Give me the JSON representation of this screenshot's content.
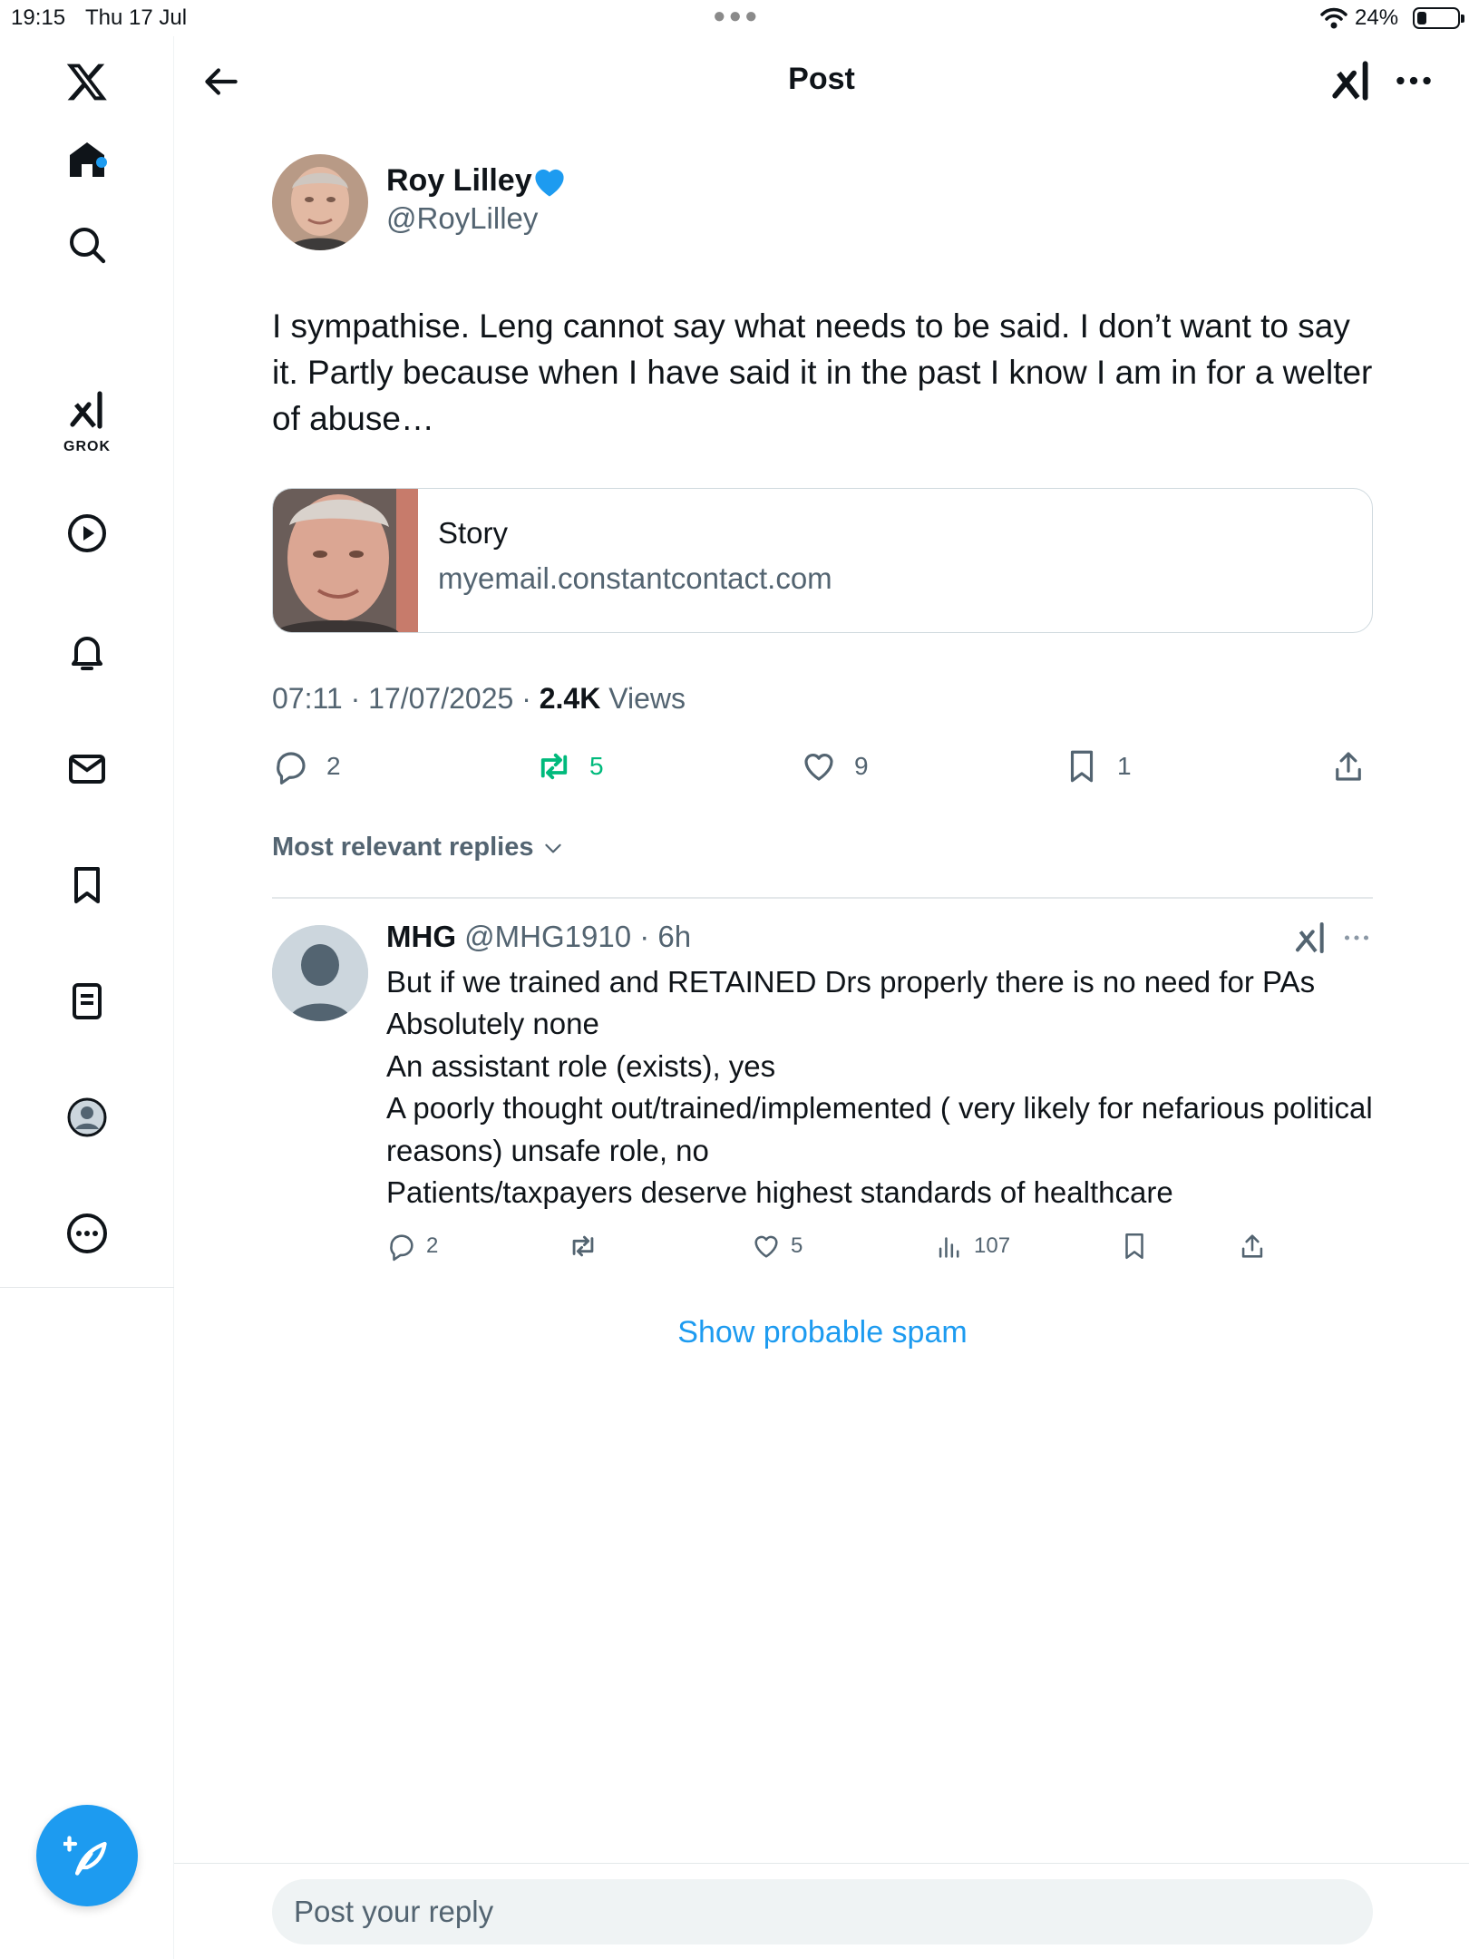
{
  "status_bar": {
    "time": "19:15",
    "date": "Thu 17 Jul",
    "battery": "24%"
  },
  "header": {
    "title": "Post"
  },
  "sidebar": {
    "grok_label": "GROK",
    "accent": "#1d9bf0"
  },
  "post": {
    "author_name": "Roy Lilley",
    "author_handle": "@RoyLilley",
    "text": "I sympathise. Leng cannot say what needs to be said. I don’t want to say it. Partly because when I have said it in the past I know I am in for a welter of abuse…",
    "link_card": {
      "title": "Story",
      "domain": "myemail.constantcontact.com"
    },
    "timestamp": "07:11 · 17/07/2025 · ",
    "views_count": "2.4K",
    "views_label": " Views",
    "actions": {
      "replies": "2",
      "reposts": "5",
      "likes": "9",
      "bookmarks": "1"
    },
    "repost_color": "#00ba7c"
  },
  "replies_section": {
    "sort_label": "Most relevant replies"
  },
  "reply": {
    "name": "MHG",
    "handle_time": " @MHG1910 · 6h",
    "text": "But if we trained and RETAINED Drs properly there is no need for PAs\nAbsolutely none\nAn assistant role (exists), yes\nA poorly thought out/trained/implemented ( very likely for nefarious political reasons) unsafe role, no\nPatients/taxpayers deserve highest standards of healthcare",
    "actions": {
      "replies": "2",
      "likes": "5",
      "views": "107"
    }
  },
  "spam_link": "Show probable spam",
  "composer": {
    "placeholder": "Post your reply"
  }
}
